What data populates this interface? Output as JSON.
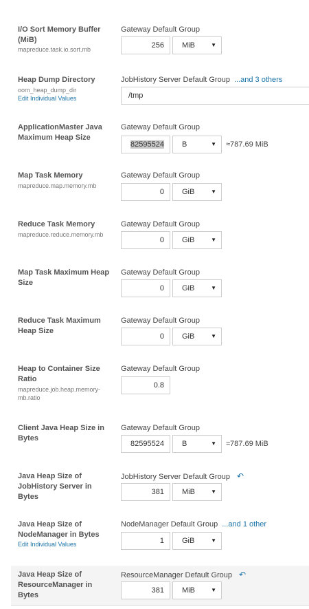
{
  "properties": [
    {
      "label": "I/O Sort Memory Buffer (MiB)",
      "property": "mapreduce.task.io.sort.mb",
      "group": "Gateway Default Group",
      "value": "256",
      "unit": "MiB"
    },
    {
      "label": "Heap Dump Directory",
      "property": "oom_heap_dump_dir",
      "edit_link": "Edit Individual Values",
      "group": "JobHistory Server Default Group",
      "others_link": "...and 3 others",
      "value": "/tmp"
    },
    {
      "label": "ApplicationMaster Java Maximum Heap Size",
      "group": "Gateway Default Group",
      "value": "82595524",
      "unit": "B",
      "approx": "≈787.69 MiB"
    },
    {
      "label": "Map Task Memory",
      "property": "mapreduce.map.memory.mb",
      "group": "Gateway Default Group",
      "value": "0",
      "unit": "GiB"
    },
    {
      "label": "Reduce Task Memory",
      "property": "mapreduce.reduce.memory.mb",
      "group": "Gateway Default Group",
      "value": "0",
      "unit": "GiB"
    },
    {
      "label": "Map Task Maximum Heap Size",
      "group": "Gateway Default Group",
      "value": "0",
      "unit": "GiB"
    },
    {
      "label": "Reduce Task Maximum Heap Size",
      "group": "Gateway Default Group",
      "value": "0",
      "unit": "GiB"
    },
    {
      "label": "Heap to Container Size Ratio",
      "property": "mapreduce.job.heap.memory-mb.ratio",
      "group": "Gateway Default Group",
      "value": "0.8"
    },
    {
      "label": "Client Java Heap Size in Bytes",
      "group": "Gateway Default Group",
      "value": "82595524",
      "unit": "B",
      "approx": "≈787.69 MiB"
    },
    {
      "label": "Java Heap Size of JobHistory Server in Bytes",
      "group": "JobHistory Server Default Group",
      "undo_icon": "undo-arrow-icon",
      "value": "381",
      "unit": "MiB"
    },
    {
      "label": "Java Heap Size of NodeManager in Bytes",
      "edit_link": "Edit Individual Values",
      "group": "NodeManager Default Group",
      "others_link": "...and 1 other",
      "value": "1",
      "unit": "GiB"
    },
    {
      "label": "Java Heap Size of ResourceManager in Bytes",
      "group": "ResourceManager Default Group",
      "undo_icon": "undo-arrow-icon",
      "value": "381",
      "unit": "MiB"
    }
  ],
  "icons": {
    "caret": "▼",
    "undo": "↶"
  },
  "colors": {
    "link": "#1a73a8",
    "label": "#555555",
    "highlight_row": "#f4f4f4"
  }
}
